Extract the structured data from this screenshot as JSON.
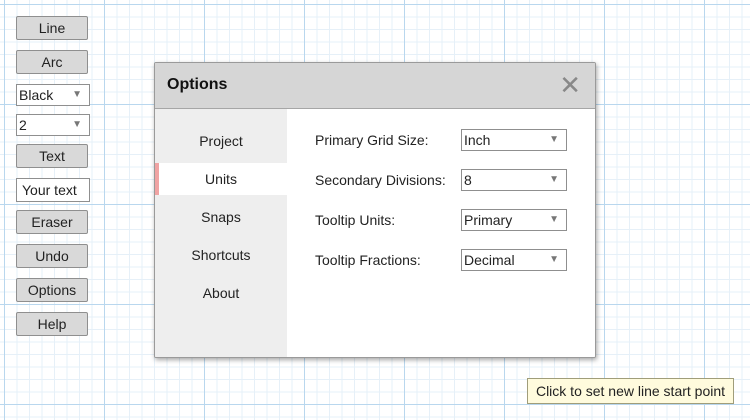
{
  "toolbar": {
    "line_label": "Line",
    "arc_label": "Arc",
    "color_value": "Black",
    "width_value": "2",
    "text_label": "Text",
    "text_input_value": "Your text",
    "eraser_label": "Eraser",
    "undo_label": "Undo",
    "options_label": "Options",
    "help_label": "Help"
  },
  "dialog": {
    "title": "Options",
    "close_glyph": "✕",
    "nav": [
      {
        "label": "Project"
      },
      {
        "label": "Units",
        "active": true
      },
      {
        "label": "Snaps"
      },
      {
        "label": "Shortcuts"
      },
      {
        "label": "About"
      }
    ],
    "fields": [
      {
        "label": "Primary Grid Size:",
        "value": "Inch"
      },
      {
        "label": "Secondary Divisions:",
        "value": "8"
      },
      {
        "label": "Tooltip Units:",
        "value": "Primary"
      },
      {
        "label": "Tooltip Fractions:",
        "value": "Decimal"
      }
    ]
  },
  "tooltip": {
    "text": "Click to set new line start point"
  },
  "colors": {
    "grid_major": "#b9d7ee",
    "grid_minor": "#e6f0f8",
    "active_nav_marker": "#f0a3a3",
    "tooltip_bg": "#fffbdd"
  },
  "icons": {
    "dropdown": "triangle-down-icon",
    "close": "close-icon"
  }
}
